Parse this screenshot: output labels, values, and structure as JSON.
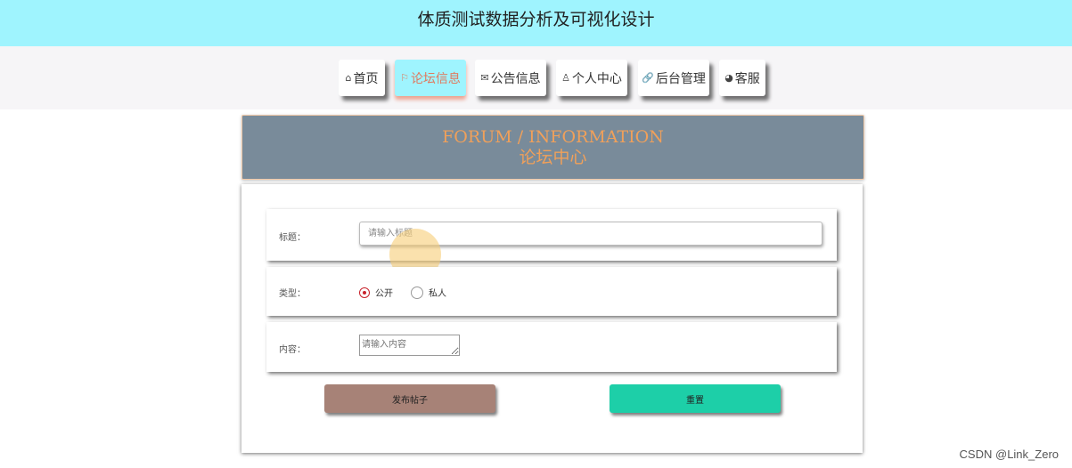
{
  "header": {
    "title": "体质测试数据分析及可视化设计"
  },
  "nav": {
    "items": [
      {
        "icon": "⌂",
        "label": "首页"
      },
      {
        "icon": "⚐",
        "label": "论坛信息"
      },
      {
        "icon": "✉",
        "label": "公告信息"
      },
      {
        "icon": "♙",
        "label": "个人中心"
      },
      {
        "icon": "🔗",
        "label": "后台管理"
      },
      {
        "icon": "◕",
        "label": "客服"
      }
    ],
    "active_index": 1
  },
  "banner": {
    "en": "FORUM / INFORMATION",
    "zh": "论坛中心"
  },
  "form": {
    "title_label": "标题：",
    "title_placeholder": "请输入标题",
    "type_label": "类型：",
    "type_options": [
      "公开",
      "私人"
    ],
    "type_selected": "公开",
    "content_label": "内容：",
    "content_placeholder": "请输入内容",
    "submit_label": "发布帖子",
    "reset_label": "重置"
  },
  "colors": {
    "topbar": "#9ff4fe",
    "banner": "#798b9a",
    "banner_text": "#f0a05a",
    "submit_button": "#a78277",
    "reset_button": "#1dcfa8"
  },
  "watermark": "CSDN @Link_Zero"
}
